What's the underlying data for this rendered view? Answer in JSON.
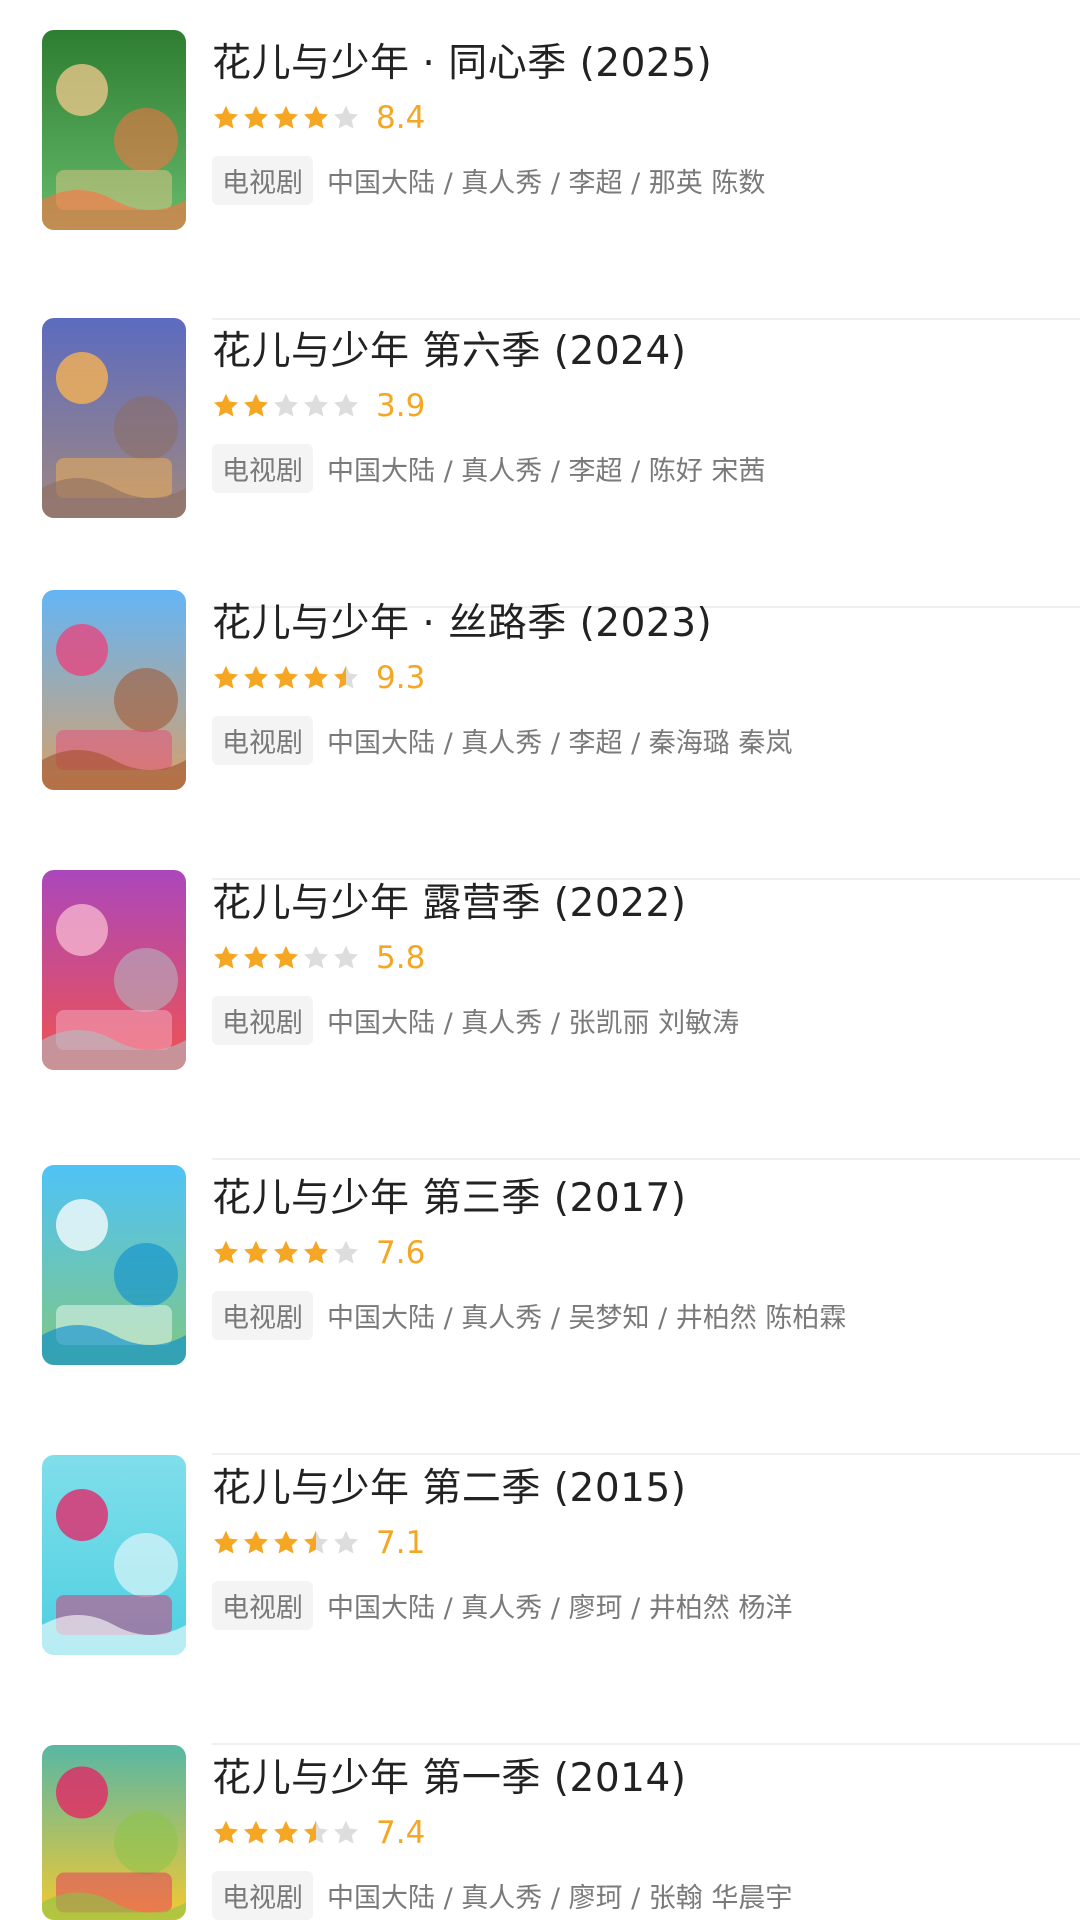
{
  "items": [
    {
      "title": "花儿与少年 · 同心季 (2025)",
      "rating": 8.4,
      "rating_text": "8.4",
      "stars_filled": 4.0,
      "tag": "电视剧",
      "meta": "中国大陆 / 真人秀 / 李超 / 那英 陈数",
      "poster_colors": [
        "#2e7d32",
        "#66bb6a",
        "#f4c98f",
        "#ff7043"
      ]
    },
    {
      "title": "花儿与少年 第六季 (2024)",
      "rating": 3.9,
      "rating_text": "3.9",
      "stars_filled": 2.0,
      "tag": "电视剧",
      "meta": "中国大陆 / 真人秀 / 李超 / 陈好 宋茜",
      "poster_colors": [
        "#5c6bc0",
        "#a1887f",
        "#ffb74d",
        "#8d6e63"
      ]
    },
    {
      "title": "花儿与少年 · 丝路季 (2023)",
      "rating": 9.3,
      "rating_text": "9.3",
      "stars_filled": 4.5,
      "tag": "电视剧",
      "meta": "中国大陆 / 真人秀 / 李超 / 秦海璐 秦岚",
      "poster_colors": [
        "#64b5f6",
        "#d7a06a",
        "#ec407a",
        "#a0522d"
      ]
    },
    {
      "title": "花儿与少年 露营季 (2022)",
      "rating": 5.8,
      "rating_text": "5.8",
      "stars_filled": 3.0,
      "tag": "电视剧",
      "meta": "中国大陆 / 真人秀 / 张凯丽 刘敏涛",
      "poster_colors": [
        "#ab47bc",
        "#ef5350",
        "#f8bbd0",
        "#b0bec5"
      ]
    },
    {
      "title": "花儿与少年 第三季 (2017)",
      "rating": 7.6,
      "rating_text": "7.6",
      "stars_filled": 4.0,
      "tag": "电视剧",
      "meta": "中国大陆 / 真人秀 / 吴梦知 / 井柏然 陈柏霖",
      "poster_colors": [
        "#4fc3f7",
        "#81c784",
        "#ffffff",
        "#0288d1"
      ]
    },
    {
      "title": "花儿与少年 第二季 (2015)",
      "rating": 7.1,
      "rating_text": "7.1",
      "stars_filled": 3.5,
      "tag": "电视剧",
      "meta": "中国大陆 / 真人秀 / 廖珂 / 井柏然 杨洋",
      "poster_colors": [
        "#80deea",
        "#4dd0e1",
        "#e91e63",
        "#ffffff"
      ]
    },
    {
      "title": "花儿与少年 第一季 (2014)",
      "rating": 7.4,
      "rating_text": "7.4",
      "stars_filled": 3.5,
      "tag": "电视剧",
      "meta": "中国大陆 / 真人秀 / 廖珂 / 张翰 华晨宇",
      "poster_colors": [
        "#4db6ac",
        "#ffca28",
        "#e91e63",
        "#8bc34a"
      ]
    }
  ],
  "colors": {
    "star_filled": "#f5a623",
    "star_empty": "#dddddd",
    "text_primary": "#222222",
    "text_secondary": "#7a7a7a",
    "tag_bg": "#f4f4f4"
  }
}
